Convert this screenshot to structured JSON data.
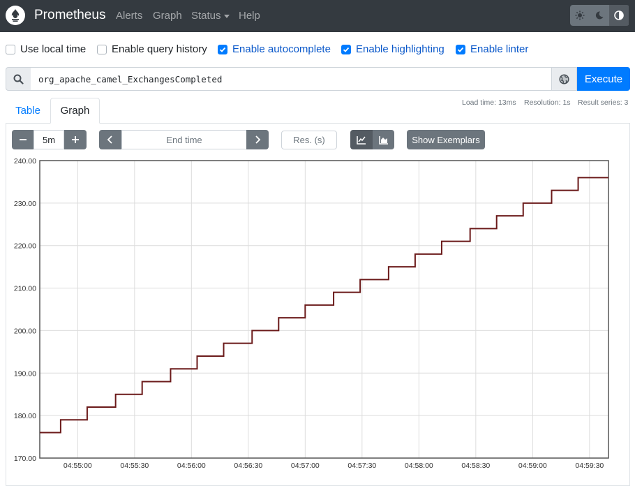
{
  "navbar": {
    "brand": "Prometheus",
    "links": {
      "alerts": "Alerts",
      "graph": "Graph",
      "status": "Status",
      "help": "Help"
    }
  },
  "options": {
    "local_time": {
      "label": "Use local time",
      "checked": false
    },
    "query_history": {
      "label": "Enable query history",
      "checked": false
    },
    "autocomplete": {
      "label": "Enable autocomplete",
      "checked": true
    },
    "highlighting": {
      "label": "Enable highlighting",
      "checked": true
    },
    "linter": {
      "label": "Enable linter",
      "checked": true
    }
  },
  "query": {
    "value": "org_apache_camel_ExchangesCompleted",
    "execute_label": "Execute"
  },
  "stats": {
    "load_time": "Load time: 13ms",
    "resolution": "Resolution: 1s",
    "result_series": "Result series: 3"
  },
  "tabs": {
    "table": "Table",
    "graph": "Graph"
  },
  "controls": {
    "range": "5m",
    "end_time_placeholder": "End time",
    "resolution_placeholder": "Res. (s)",
    "exemplars_label": "Show Exemplars"
  },
  "colors": {
    "accent": "#007bff",
    "navbar": "#343a40",
    "line": "#6b1a1a"
  },
  "icons": {
    "logo": "prometheus-flame-icon",
    "search": "search-icon",
    "globe": "globe-icon",
    "range_minus": "minus-icon",
    "range_plus": "plus-icon",
    "prev": "chevron-left-icon",
    "next": "chevron-right-icon",
    "line_chart": "line-chart-icon",
    "stacked_chart": "area-chart-icon",
    "theme": [
      "sun-icon",
      "moon-icon",
      "contrast-icon"
    ]
  },
  "chart_data": {
    "type": "line",
    "title": "",
    "xlabel": "",
    "ylabel": "",
    "ylim": [
      170,
      240
    ],
    "y_ticks": [
      "170.00",
      "180.00",
      "190.00",
      "200.00",
      "210.00",
      "220.00",
      "230.00",
      "240.00"
    ],
    "x_range": [
      "04:54:40",
      "04:59:40"
    ],
    "x_ticks": [
      "04:55:00",
      "04:55:30",
      "04:56:00",
      "04:56:30",
      "04:57:00",
      "04:57:30",
      "04:58:00",
      "04:58:30",
      "04:59:00",
      "04:59:30"
    ],
    "grid": true,
    "series": [
      {
        "x": [
          "04:54:40",
          "04:54:51",
          "04:55:05",
          "04:55:20",
          "04:55:34",
          "04:55:49",
          "04:56:03",
          "04:56:17",
          "04:56:32",
          "04:56:46",
          "04:57:00",
          "04:57:15",
          "04:57:29",
          "04:57:44",
          "04:57:58",
          "04:58:12",
          "04:58:27",
          "04:58:41",
          "04:58:55",
          "04:59:10",
          "04:59:24",
          "04:59:38",
          "04:59:40"
        ],
        "values": [
          176,
          179,
          182,
          185,
          188,
          191,
          194,
          197,
          200,
          203,
          206,
          209,
          212,
          215,
          218,
          221,
          224,
          227,
          230,
          233,
          236,
          236,
          236
        ]
      }
    ]
  }
}
